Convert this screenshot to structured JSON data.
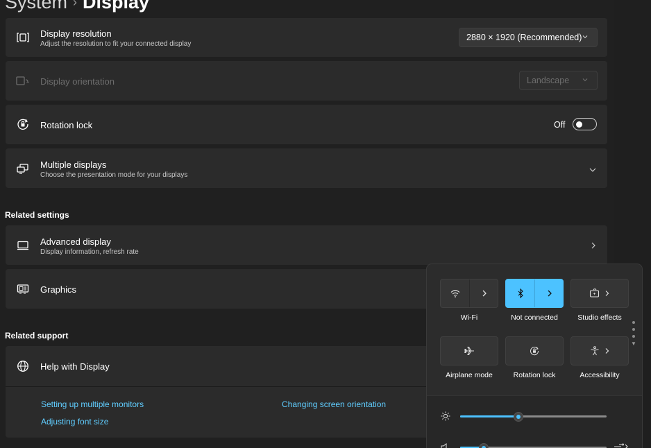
{
  "header": {
    "crumb": "System",
    "separator": "›",
    "page": "Display"
  },
  "cards": {
    "resolution": {
      "title": "Display resolution",
      "subtitle": "Adjust the resolution to fit your connected display",
      "value": "2880 × 1920 (Recommended)",
      "icon": "resolution-icon"
    },
    "orientation": {
      "title": "Display orientation",
      "value": "Landscape",
      "icon": "orientation-icon"
    },
    "rotation_lock": {
      "title": "Rotation lock",
      "state": "Off",
      "icon": "rotation-lock-icon"
    },
    "multiple_displays": {
      "title": "Multiple displays",
      "subtitle": "Choose the presentation mode for your displays",
      "icon": "multiple-displays-icon"
    }
  },
  "related_settings": {
    "heading": "Related settings",
    "advanced": {
      "title": "Advanced display",
      "subtitle": "Display information, refresh rate",
      "icon": "monitor-icon"
    },
    "graphics": {
      "title": "Graphics",
      "icon": "graphics-icon"
    }
  },
  "related_support": {
    "heading": "Related support",
    "help": {
      "title": "Help with Display",
      "icon": "globe-icon"
    },
    "links": [
      "Setting up multiple monitors",
      "Changing screen orientation",
      "Adjusting font size"
    ]
  },
  "quick_settings": {
    "tiles": [
      {
        "label": "Wi-Fi",
        "icon": "wifi-icon",
        "active": false
      },
      {
        "label": "Not connected",
        "icon": "bluetooth-icon",
        "active": true
      },
      {
        "label": "Studio effects",
        "icon": "studio-effects-icon",
        "active": false
      },
      {
        "label": "Airplane mode",
        "icon": "airplane-icon",
        "active": false
      },
      {
        "label": "Rotation lock",
        "icon": "rotation-lock-icon",
        "active": false
      },
      {
        "label": "Accessibility",
        "icon": "accessibility-icon",
        "active": false
      }
    ],
    "brightness": {
      "icon": "brightness-icon",
      "level_fraction": 0.4
    },
    "volume": {
      "icon": "speaker-icon",
      "level_fraction": 0.16
    },
    "colors": {
      "accent": "#4cc2ff",
      "link": "#60cdff"
    }
  }
}
